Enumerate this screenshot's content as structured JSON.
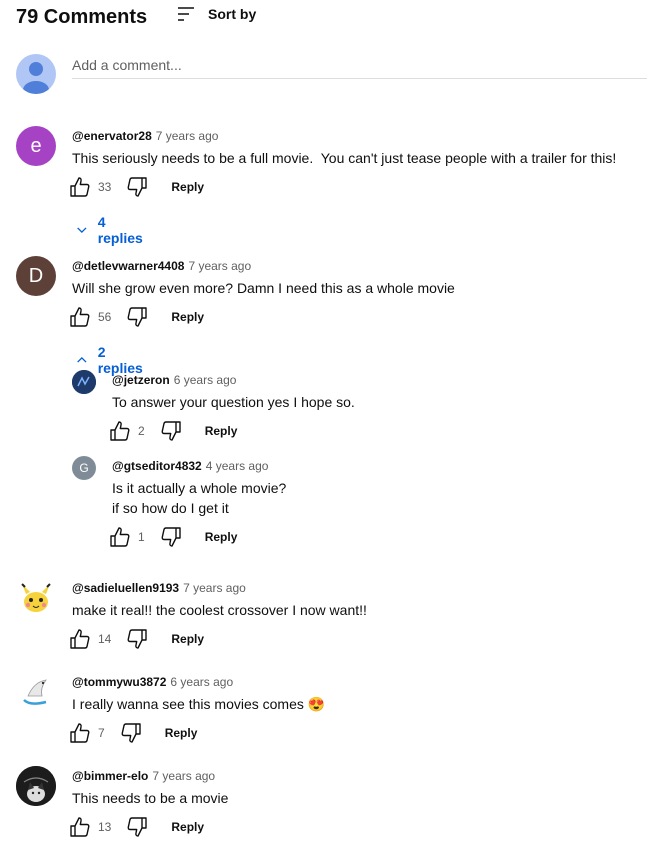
{
  "header": {
    "count_title": "79 Comments",
    "sort_label": "Sort by"
  },
  "add_comment": {
    "placeholder": "Add a comment..."
  },
  "comments": [
    {
      "author": "@enervator28",
      "time": "7 years ago",
      "text": "This seriously needs to be a full movie.  You can't just tease people with a trailer for this!",
      "likes": "33",
      "reply": "Reply",
      "avatar_letter": "e",
      "avatar_color": "#a642c4",
      "replies_toggle": "4 replies"
    },
    {
      "author": "@detlevwarner4408",
      "time": "7 years ago",
      "text": "Will she grow even more? Damn I need this as a whole movie",
      "likes": "56",
      "reply": "Reply",
      "avatar_letter": "D",
      "avatar_color": "#5d4037",
      "replies_toggle": "2 replies",
      "replies": [
        {
          "author": "@jetzeron",
          "time": "6 years ago",
          "text": "To answer your question yes I hope so.",
          "likes": "2",
          "reply": "Reply",
          "avatar_color": "#1d3a6b"
        },
        {
          "author": "@gtseditor4832",
          "time": "4 years ago",
          "text_line1": "Is it actually a whole movie?",
          "text_line2": "if so how do I get it",
          "likes": "1",
          "reply": "Reply",
          "avatar_letter": "G",
          "avatar_color": "#7f8c97"
        }
      ]
    },
    {
      "author": "@sadieluellen9193",
      "time": "7 years ago",
      "text": "make it real!! the coolest crossover I now want!!",
      "likes": "14",
      "reply": "Reply"
    },
    {
      "author": "@tommywu3872",
      "time": "6 years ago",
      "text": "I really wanna see this movies comes",
      "emoji": "😍",
      "likes": "7",
      "reply": "Reply"
    },
    {
      "author": "@bimmer-elo",
      "time": "7 years ago",
      "text": "This needs to be a movie",
      "likes": "13",
      "reply": "Reply"
    }
  ],
  "colors": {
    "link_blue": "#065fd4",
    "secondary_text": "#606060"
  }
}
